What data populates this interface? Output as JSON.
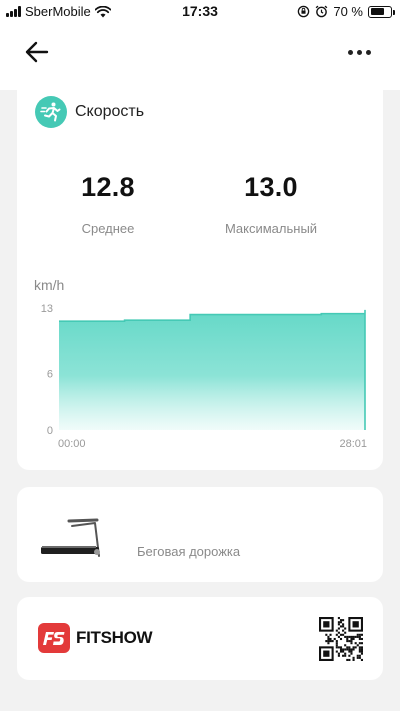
{
  "status_bar": {
    "carrier": "SberMobile",
    "time": "17:33",
    "battery": "70 %",
    "battery_level": 0.7
  },
  "nav": {
    "back_icon": "arrow-left-icon",
    "more_icon": "more-horizontal-icon"
  },
  "speed": {
    "title": "Скорость",
    "icon": "running-person-icon",
    "average_value": "12.8",
    "average_label": "Среднее",
    "max_value": "13.0",
    "max_label": "Максимальный",
    "unit": "km/h"
  },
  "chart_data": {
    "type": "area",
    "ylabel": "km/h",
    "y_ticks": [
      "13",
      "6",
      "0"
    ],
    "ylim": [
      0,
      13
    ],
    "x_tick_labels": [
      "00:00",
      "28:01"
    ],
    "x_minutes": [
      0,
      6,
      12,
      18,
      24,
      28
    ],
    "values": [
      11.6,
      11.7,
      12.3,
      12.3,
      12.4,
      12.8
    ],
    "color": "#45c9b5"
  },
  "treadmill": {
    "label": "Беговая дорожка",
    "icon": "treadmill-icon"
  },
  "brand": {
    "name": "FITSHOW",
    "logo_text": "FS",
    "logo_color": "#e33a3a",
    "qr_icon": "qr-code-icon"
  }
}
